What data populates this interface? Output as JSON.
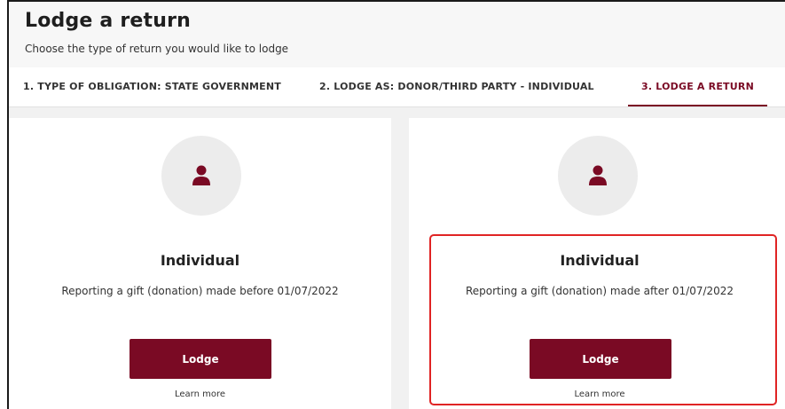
{
  "header": {
    "title": "Lodge a return",
    "subtitle": "Choose the type of return you would like to lodge"
  },
  "steps": [
    {
      "label": "1. TYPE OF OBLIGATION: STATE GOVERNMENT"
    },
    {
      "label": "2. LODGE AS: DONOR/THIRD PARTY - INDIVIDUAL"
    },
    {
      "label": "3. LODGE A RETURN",
      "active": true
    }
  ],
  "cards": [
    {
      "icon": "person-icon",
      "title": "Individual",
      "description": "Reporting a gift (donation) made before 01/07/2022",
      "button_label": "Lodge",
      "learn_more": "Learn more"
    },
    {
      "icon": "person-icon",
      "title": "Individual",
      "description": "Reporting a gift (donation) made after 01/07/2022",
      "button_label": "Lodge",
      "learn_more": "Learn more"
    }
  ],
  "colors": {
    "accent": "#7a0a24",
    "highlight": "#e02424"
  }
}
